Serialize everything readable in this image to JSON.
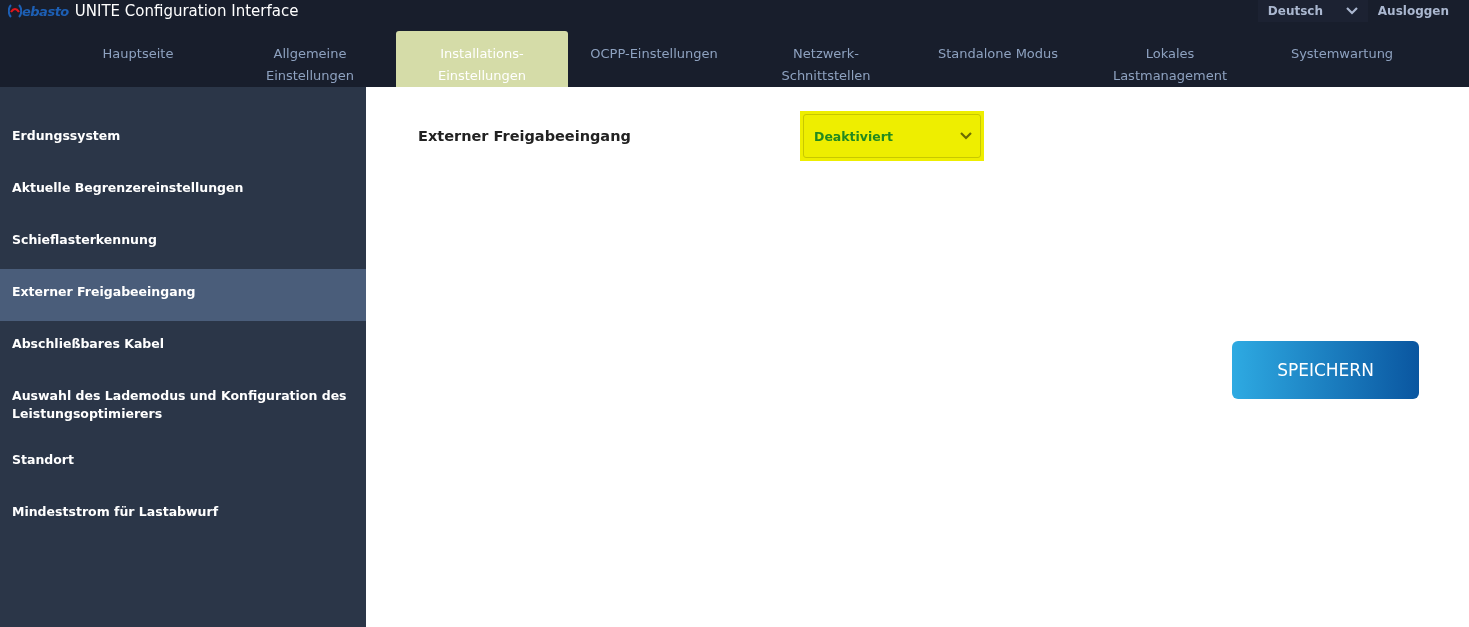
{
  "header": {
    "logo_text": "ebasto",
    "title": "UNITE Configuration Interface",
    "language": {
      "value": "Deutsch"
    },
    "logout": "Ausloggen"
  },
  "tabs": [
    {
      "lines": [
        "Hauptseite"
      ],
      "selected": false
    },
    {
      "lines": [
        "Allgemeine",
        "Einstellungen"
      ],
      "selected": false
    },
    {
      "lines": [
        "Installations-",
        "Einstellungen"
      ],
      "selected": true
    },
    {
      "lines": [
        "OCPP-Einstellungen"
      ],
      "selected": false
    },
    {
      "lines": [
        "Netzwerk-",
        "Schnittstellen"
      ],
      "selected": false
    },
    {
      "lines": [
        "Standalone Modus"
      ],
      "selected": false
    },
    {
      "lines": [
        "Lokales",
        "Lastmanagement"
      ],
      "selected": false
    },
    {
      "lines": [
        "Systemwartung"
      ],
      "selected": false
    }
  ],
  "sidebar": {
    "items": [
      {
        "label": "Erdungssystem",
        "selected": false
      },
      {
        "label": "Aktuelle Begrenzereinstellungen",
        "selected": false
      },
      {
        "label": "Schieflasterkennung",
        "selected": false
      },
      {
        "label": "Externer Freigabeeingang",
        "selected": true
      },
      {
        "label": "Abschließbares Kabel",
        "selected": false
      },
      {
        "label": "Auswahl des Lademodus und Konfiguration des Leistungsoptimierers",
        "selected": false
      },
      {
        "label": "Standort",
        "selected": false
      },
      {
        "label": "Mindeststrom für Lastabwurf",
        "selected": false
      }
    ]
  },
  "setting": {
    "label": "Externer Freigabeeingang",
    "value": "Deaktiviert",
    "highlighted": true
  },
  "save_button": "SPEICHERN"
}
